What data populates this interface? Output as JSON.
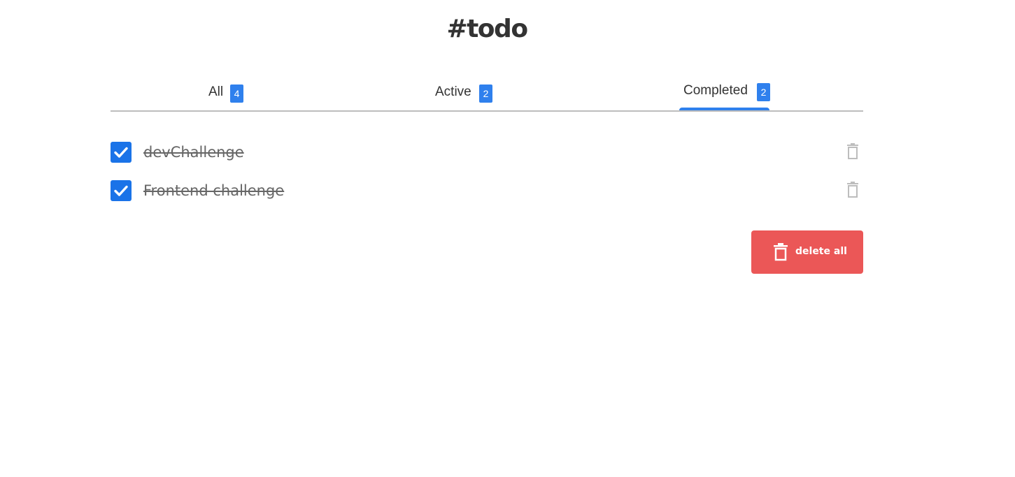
{
  "app": {
    "title": "#todo"
  },
  "tabs": [
    {
      "label": "All",
      "count": "4",
      "selected": false
    },
    {
      "label": "Active",
      "count": "2",
      "selected": false
    },
    {
      "label": "Completed",
      "count": "2",
      "selected": true
    }
  ],
  "todos": [
    {
      "text": "devChallenge",
      "completed": true,
      "delete_icon": "trash-icon"
    },
    {
      "text": "Frontend challenge",
      "completed": true,
      "delete_icon": "trash-icon"
    }
  ],
  "actions": {
    "delete_all_label": "delete all",
    "delete_all_icon": "trash-icon"
  },
  "colors": {
    "accent": "#2f80ed",
    "checkbox": "#1a73e8",
    "danger": "#eb5757",
    "text": "#333333",
    "completed_text": "#666666",
    "muted_icon": "#bdbdbd"
  }
}
